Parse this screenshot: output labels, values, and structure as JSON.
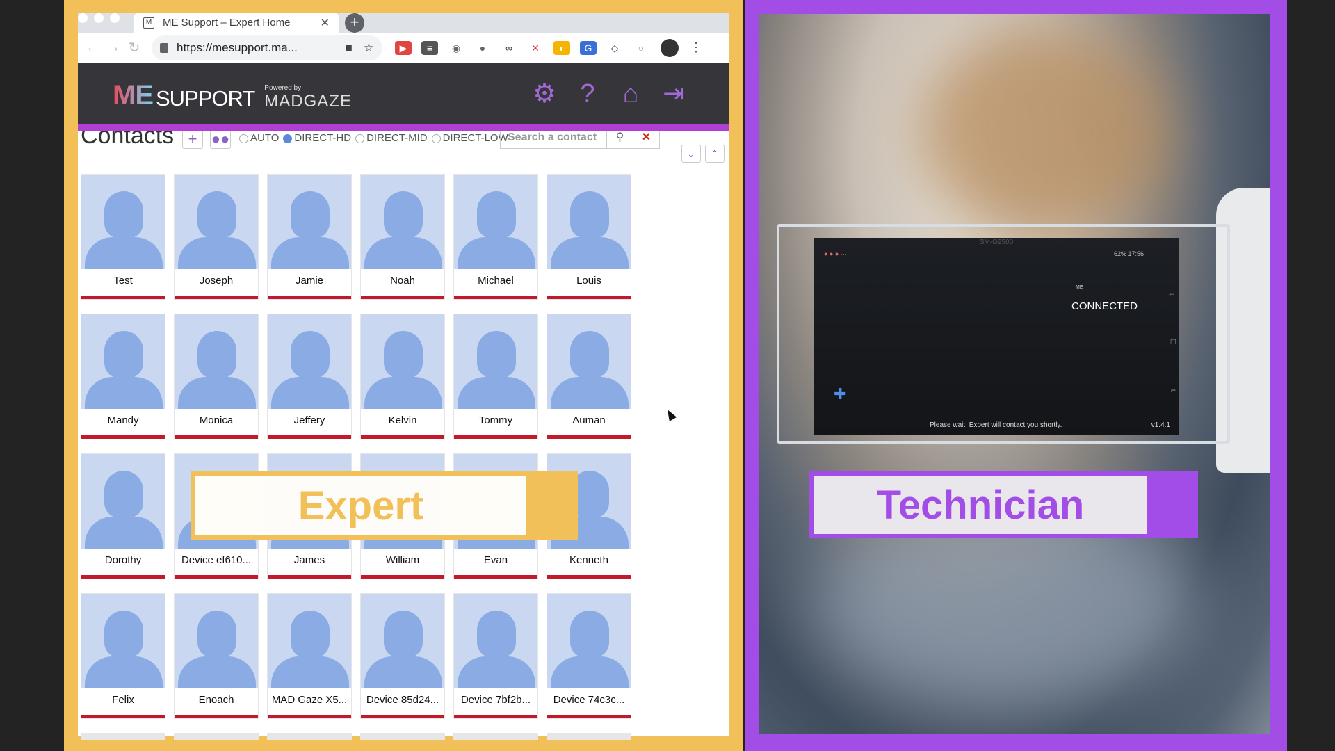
{
  "browser": {
    "tab_title": "ME Support – Expert Home",
    "url": "https://mesupport.ma..."
  },
  "app": {
    "logo_me": "ME",
    "logo_support": "SUPPORT",
    "powered_by": "Powered by",
    "powered_brand": "MADGAZE",
    "header_icons": [
      "gear-icon",
      "help-icon",
      "home-icon",
      "logout-icon"
    ]
  },
  "contacts": {
    "title": "Contacts",
    "quality_options": [
      {
        "label": "AUTO",
        "selected": false
      },
      {
        "label": "DIRECT-HD",
        "selected": true
      },
      {
        "label": "DIRECT-MID",
        "selected": false
      },
      {
        "label": "DIRECT-LOW",
        "selected": false
      }
    ],
    "search_placeholder": "Search a contact",
    "items": [
      "Test",
      "Joseph",
      "Jamie",
      "Noah",
      "Michael",
      "Louis",
      "Mandy",
      "Monica",
      "Jeffery",
      "Kelvin",
      "Tommy",
      "Auman",
      "Dorothy",
      "Device ef610...",
      "James",
      "William",
      "Evan",
      "Kenneth",
      "Felix",
      "Enoach",
      "MAD Gaze X5...",
      "Device 85d24...",
      "Device 7bf2b...",
      "Device 74c3c..."
    ]
  },
  "overlays": {
    "expert_label": "Expert",
    "technician_label": "Technician"
  },
  "device_screen": {
    "model": "SM-G9500",
    "status": "62% 17:56",
    "connected": "CONNECTED",
    "wait_message": "Please wait. Expert will contact you shortly.",
    "version": "v1.4.1"
  },
  "colors": {
    "expert_accent": "#f2c059",
    "technician_accent": "#a24de6",
    "header_icon": "#a169d6",
    "contact_bar": "#c21a2a"
  }
}
